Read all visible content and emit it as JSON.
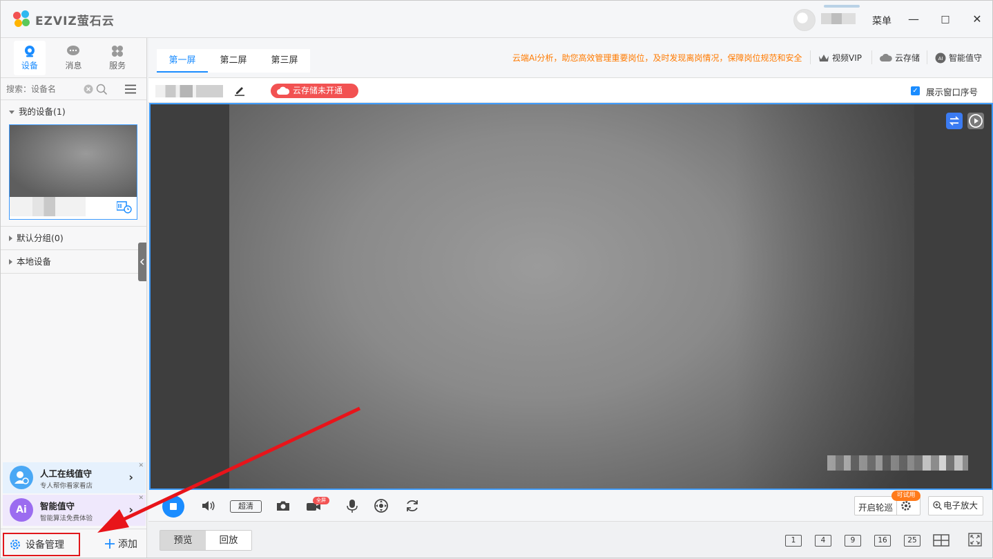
{
  "app": {
    "logo_text": "EZVIZ萤石云",
    "menu_label": "菜单",
    "window_controls": {
      "minimize": "—",
      "maximize": "□",
      "close": "✕"
    }
  },
  "sidebar": {
    "tabs": [
      {
        "label": "设备",
        "icon": "camera-icon",
        "active": true
      },
      {
        "label": "消息",
        "icon": "message-icon",
        "active": false
      },
      {
        "label": "服务",
        "icon": "apps-icon",
        "active": false
      }
    ],
    "search": {
      "placeholder": "搜索：设备名"
    },
    "groups": {
      "my_devices": "我的设备(1)",
      "default_group": "默认分组(0)",
      "local_devices": "本地设备"
    },
    "promos": [
      {
        "title": "人工在线值守",
        "subtitle": "专人帮你看家看店",
        "color": "#4aa8f5"
      },
      {
        "title": "智能值守",
        "subtitle": "智能算法免费体验",
        "color": "#9b6cf0"
      }
    ],
    "bottom": {
      "device_manage": "设备管理",
      "add": "添加"
    }
  },
  "main": {
    "screen_tabs": [
      "第一屏",
      "第二屏",
      "第三屏"
    ],
    "active_tab": "第一屏",
    "promo_text": "云端Ai分析，助您高效管理重要岗位，及时发现离岗情况，保障岗位规范和安全",
    "top_links": {
      "vip": "视频VIP",
      "cloud_storage": "云存储",
      "ai_guard": "智能值守"
    },
    "cloud_badge": "云存储未开通",
    "show_window_index": "展示窗口序号",
    "show_window_index_checked": true
  },
  "controls": {
    "quality": "超清",
    "fullscreen_badge": "全屏",
    "patrol": "开启轮巡",
    "trial_badge": "可试用",
    "digital_zoom": "电子放大"
  },
  "footer": {
    "modes": [
      "预览",
      "回放"
    ],
    "active_mode": "预览",
    "layouts": [
      "1",
      "4",
      "9",
      "16",
      "25"
    ]
  },
  "colors": {
    "accent": "#1a8cff",
    "warning": "#ff7a00",
    "badge_red": "#f25252",
    "highlight_box": "#e0161b"
  }
}
